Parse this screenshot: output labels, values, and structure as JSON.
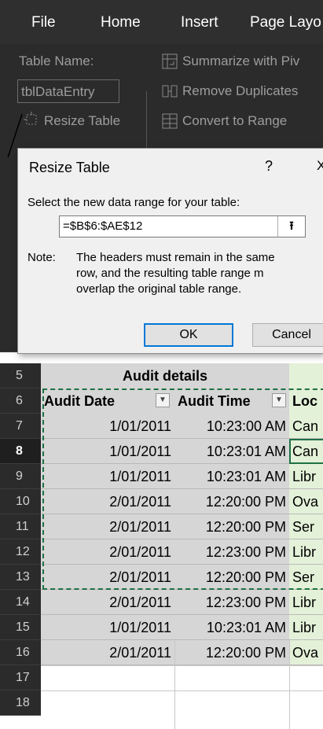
{
  "ribbon_tabs": [
    "File",
    "Home",
    "Insert",
    "Page Layo"
  ],
  "ribbon": {
    "table_name_label": "Table Name:",
    "table_name_value": "tblDataEntry",
    "resize_table": "Resize Table",
    "summarize": "Summarize with Piv",
    "remove_duplicates": "Remove Duplicates",
    "convert_to_range": "Convert to Range"
  },
  "dialog": {
    "title": "Resize Table",
    "help": "?",
    "close": "X",
    "prompt": "Select the new data range for your table:",
    "range_value": "=$B$6:$AE$12",
    "note_label": "Note:",
    "note_lines": [
      "The headers must remain in the same",
      "row, and the resulting table range m",
      "overlap the original table range."
    ],
    "ok": "OK",
    "cancel": "Cancel"
  },
  "sheet": {
    "row_numbers": [
      "5",
      "6",
      "7",
      "8",
      "9",
      "10",
      "11",
      "12",
      "13",
      "14",
      "15",
      "16",
      "17",
      "18"
    ],
    "active_row": "8",
    "group_header": "Audit details",
    "headers": [
      "Audit Date",
      "Audit Time",
      "Loc"
    ],
    "rows": [
      {
        "date": "1/01/2011",
        "time": "10:23:00 AM",
        "loc": "Can"
      },
      {
        "date": "1/01/2011",
        "time": "10:23:01 AM",
        "loc": "Can"
      },
      {
        "date": "1/01/2011",
        "time": "10:23:01 AM",
        "loc": "Libr"
      },
      {
        "date": "2/01/2011",
        "time": "12:20:00 PM",
        "loc": "Ova"
      },
      {
        "date": "2/01/2011",
        "time": "12:20:00 PM",
        "loc": "Ser"
      },
      {
        "date": "2/01/2011",
        "time": "12:23:00 PM",
        "loc": "Libr"
      },
      {
        "date": "2/01/2011",
        "time": "12:20:00 PM",
        "loc": "Ser"
      },
      {
        "date": "2/01/2011",
        "time": "12:23:00 PM",
        "loc": "Libr"
      },
      {
        "date": "1/01/2011",
        "time": "10:23:01 AM",
        "loc": "Libr"
      },
      {
        "date": "2/01/2011",
        "time": "12:20:00 PM",
        "loc": "Ova"
      }
    ]
  },
  "colors": {
    "ribbon_bg": "#2b2b2b",
    "tab_bar_bg": "#2f2f2f",
    "dialog_bg": "#f0f0f0",
    "selection_accent": "#0078d7",
    "marching_ants": "#1e7145",
    "table_gray": "#d6d6d6",
    "table_green": "#e3f1d8"
  }
}
